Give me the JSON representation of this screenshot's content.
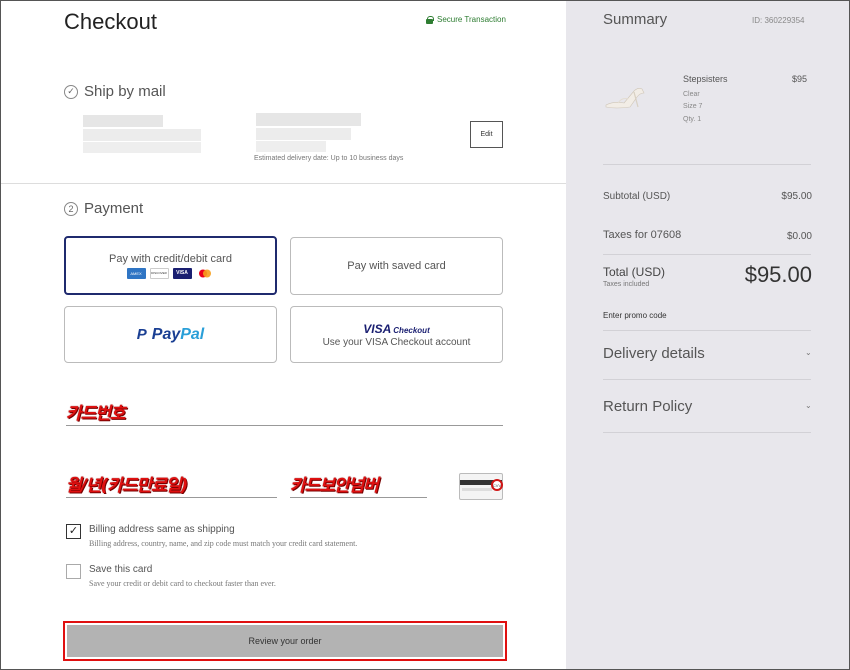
{
  "checkout": {
    "title": "Checkout",
    "secure_label": "Secure Transaction"
  },
  "shipping": {
    "step_label": "Ship by mail",
    "edit_label": "Edit",
    "estimated_delivery": "Estimated delivery date: Up to 10 business days"
  },
  "payment": {
    "step_number": "2",
    "step_label": "Payment",
    "options": {
      "card": "Pay with credit/debit card",
      "saved": "Pay with saved card",
      "paypal_1": "Pay",
      "paypal_2": "Pal",
      "visa_word": "VISA",
      "visa_checkout_word": "Checkout",
      "visa_sub": "Use your VISA Checkout account"
    },
    "card_icons": {
      "amex": "AMEX",
      "discover": "DISCOVER",
      "visa": "VISA"
    },
    "card_number_label": "카드번호",
    "expiry_label": "월/년(카드만료일)",
    "cvv_label": "카드보안넘버",
    "cvv_hint": "CVV"
  },
  "billing": {
    "same_label": "Billing address same as shipping",
    "same_sub": "Billing address, country, name, and zip code must match your credit card statement.",
    "same_checked": true,
    "save_label": "Save this card",
    "save_sub": "Save your credit or debit card to checkout faster than ever.",
    "save_checked": false
  },
  "review_label": "Review your order",
  "summary": {
    "title": "Summary",
    "id": "ID: 360229354",
    "product": {
      "name": "Stepsisters",
      "color": "Clear",
      "size": "Size 7",
      "qty": "Qty. 1",
      "price": "$95"
    },
    "subtotal_label": "Subtotal (USD)",
    "subtotal_value": "$95.00",
    "taxes_label": "Taxes for 07608",
    "taxes_value": "$0.00",
    "total_label": "Total (USD)",
    "taxes_included": "Taxes included",
    "total_value": "$95.00",
    "promo_label": "Enter promo code",
    "delivery_details": "Delivery details",
    "return_policy": "Return Policy",
    "chevron": "⌄"
  },
  "colors": {
    "selected_border": "#1f2a6e",
    "secure_green": "#2e7d32",
    "annotation_red": "#e01010",
    "summary_bg": "#e8e7ec"
  }
}
